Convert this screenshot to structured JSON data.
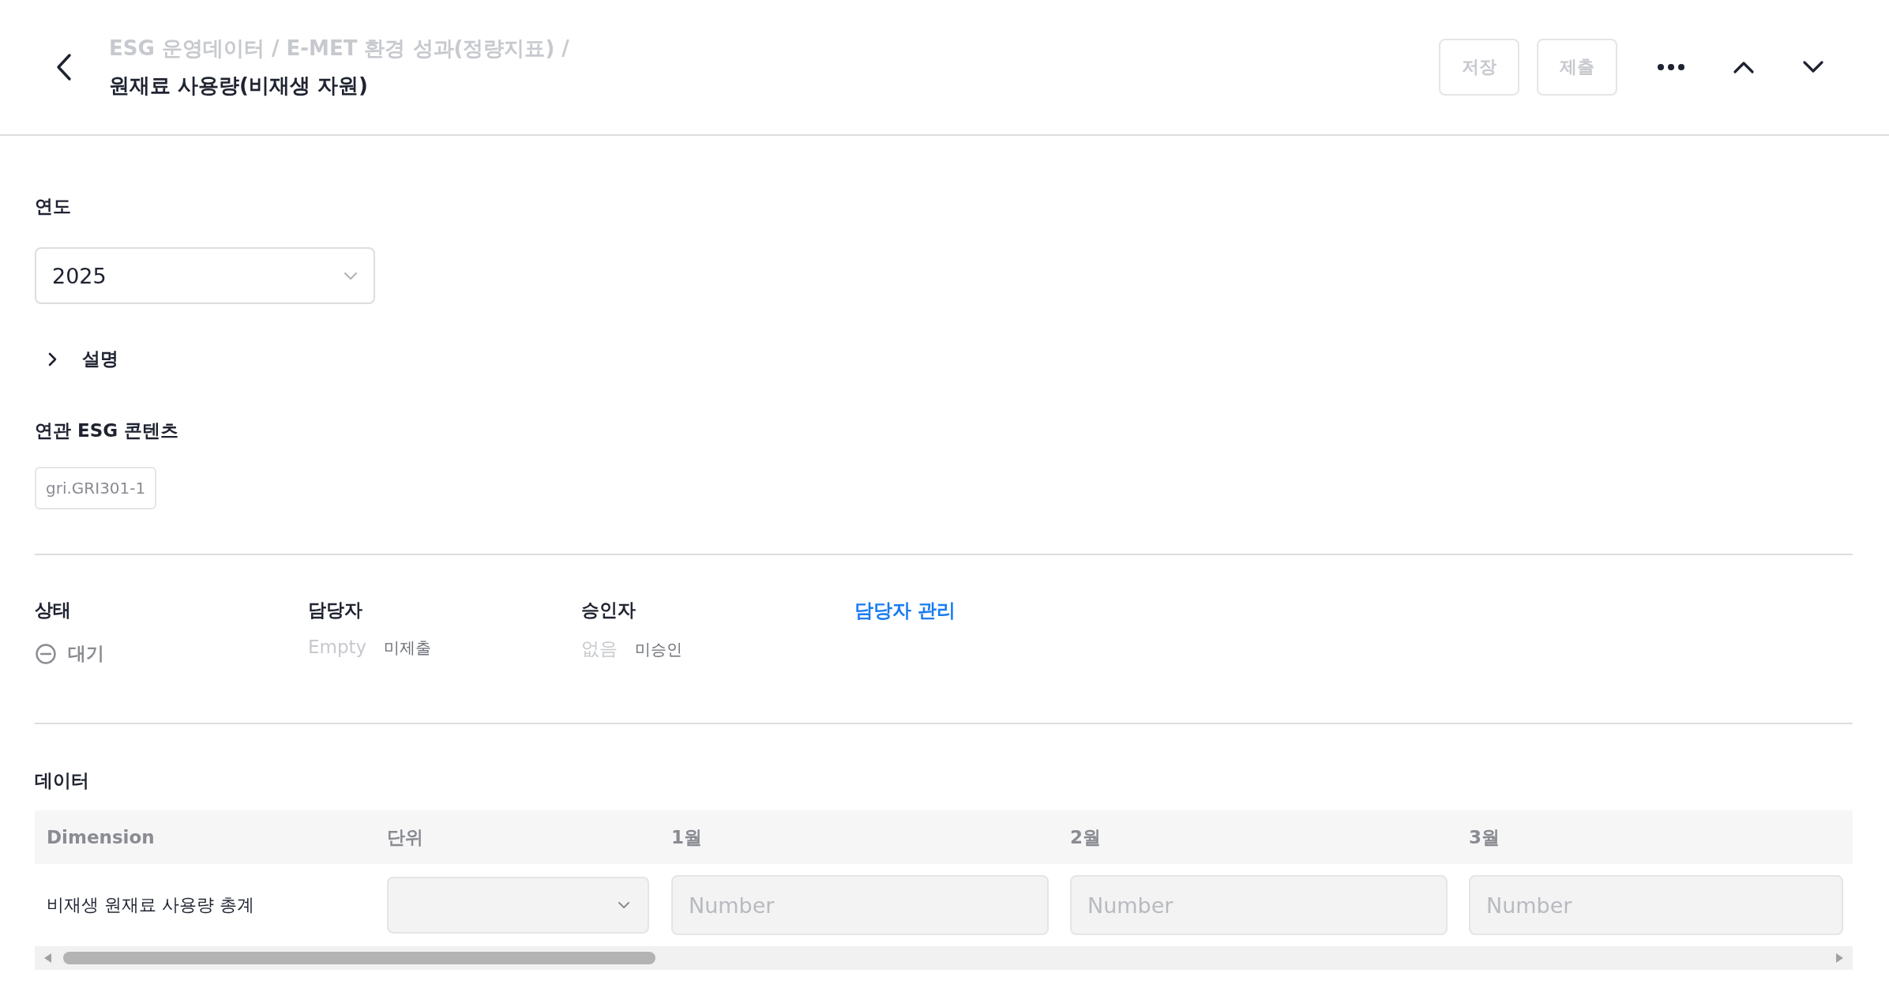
{
  "header": {
    "breadcrumb": "ESG 운영데이터 / E-MET 환경 성과(정량지표) /",
    "title": "원재료 사용량(비재생 자원)",
    "buttons": [
      {
        "label": "저장",
        "disabled": true
      },
      {
        "label": "제출",
        "disabled": true
      }
    ]
  },
  "year": {
    "label": "연도",
    "value": "2025"
  },
  "description": {
    "label": "설명",
    "expanded": false
  },
  "related": {
    "label": "연관 ESG 콘텐츠",
    "tags": [
      "gri.GRI301-1"
    ]
  },
  "people": {
    "status": {
      "label": "상태",
      "value": "대기"
    },
    "assignee": {
      "label": "담당자",
      "value": "Empty",
      "state": "미제출"
    },
    "approver": {
      "label": "승인자",
      "value": "없음",
      "state": "미승인"
    },
    "manage_link": "담당자 관리"
  },
  "data": {
    "label": "데이터",
    "table": {
      "columns": [
        "Dimension",
        "단위",
        "1월",
        "2월",
        "3월"
      ],
      "rows": [
        {
          "dimension": "비재생 원재료 사용량 총계",
          "cells": [
            {
              "kind": "select"
            },
            {
              "kind": "number",
              "placeholder": "Number"
            },
            {
              "kind": "number",
              "placeholder": "Number"
            },
            {
              "kind": "number",
              "placeholder": "Number"
            }
          ]
        }
      ]
    }
  }
}
